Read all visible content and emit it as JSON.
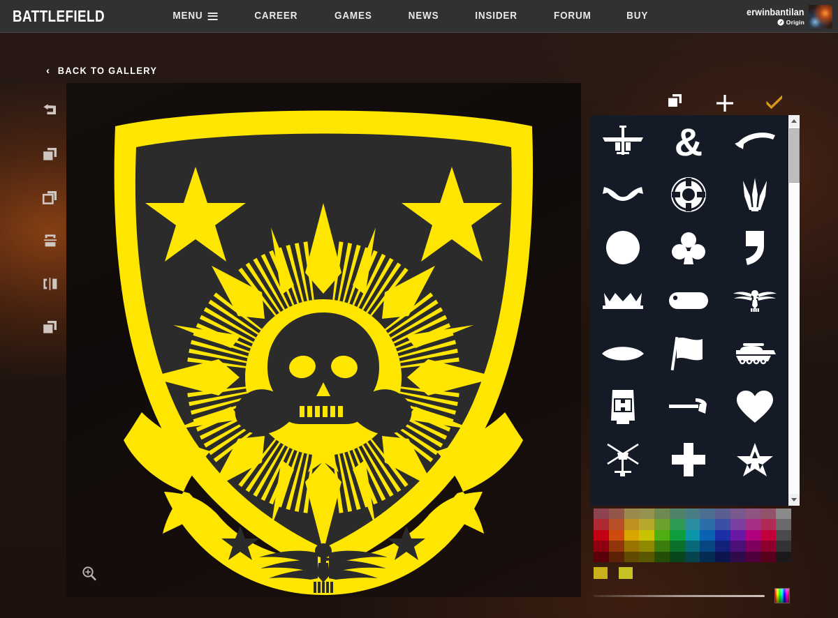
{
  "site": {
    "brand": "BATTLEFIELD",
    "nav": [
      {
        "label": "MENU",
        "icon": "hamburger-icon"
      },
      {
        "label": "CAREER",
        "icon": ""
      },
      {
        "label": "GAMES",
        "icon": ""
      },
      {
        "label": "NEWS",
        "icon": ""
      },
      {
        "label": "INSIDER",
        "icon": ""
      },
      {
        "label": "FORUM",
        "icon": ""
      },
      {
        "label": "BUY",
        "icon": ""
      }
    ],
    "user": {
      "username": "erwinbantilan",
      "platform": "Origin",
      "platform_icon": "origin-icon",
      "avatar_icon": "user-avatar"
    }
  },
  "back_link": {
    "chevron": "‹",
    "label": "BACK TO GALLERY"
  },
  "left_toolbar": {
    "items": [
      {
        "name": "undo-button",
        "icon": "undo-arrow-icon"
      },
      {
        "name": "duplicate-layer-button",
        "icon": "duplicate-filled-icon"
      },
      {
        "name": "copy-layer-button",
        "icon": "copy-outline-icon"
      },
      {
        "name": "flip-vertical-button",
        "icon": "flip-vertical-icon"
      },
      {
        "name": "flip-horizontal-button",
        "icon": "flip-horizontal-icon"
      },
      {
        "name": "layer-order-button",
        "icon": "layers-stack-icon"
      }
    ]
  },
  "canvas": {
    "zoom_button_icon": "zoom-in-icon",
    "emblem": {
      "name": "philippine-skull-shield-emblem",
      "shield_color": "#FFE600",
      "shield_fill": "#2B2B2B",
      "accent_color": "#FFE600",
      "background": "#120C0A",
      "layers": [
        {
          "name": "shield-outline",
          "color": "#FFE600"
        },
        {
          "name": "star-top-left",
          "color": "#FFE600"
        },
        {
          "name": "star-top-right",
          "color": "#FFE600"
        },
        {
          "name": "philippine-sunburst",
          "color": "#FFE600"
        },
        {
          "name": "skull-and-crossbones",
          "color": "#2B2B2B"
        },
        {
          "name": "small-star",
          "color": "#FFE600"
        },
        {
          "name": "ribbon-banner",
          "color": "#FFE600"
        },
        {
          "name": "banner-star-left",
          "color": "#2B2B2B"
        },
        {
          "name": "banner-star-right",
          "color": "#2B2B2B"
        },
        {
          "name": "eagle-insignia",
          "color": "#2B2B2B"
        }
      ]
    }
  },
  "right_panel": {
    "tabs": [
      {
        "name": "tab-layers",
        "icon": "layers-icon",
        "label": "",
        "active": false
      },
      {
        "name": "tab-add-shape",
        "icon": "plus-icon",
        "label": "",
        "active": true
      },
      {
        "name": "tab-confirm",
        "icon": "checkmark-icon",
        "label": "",
        "active": false,
        "color": "#D79A17"
      }
    ],
    "icon_grid": {
      "columns": 3,
      "icons": [
        {
          "name": "airplane-icon"
        },
        {
          "name": "ampersand-icon"
        },
        {
          "name": "curved-arrow-icon"
        },
        {
          "name": "banner-ribbon-icon"
        },
        {
          "name": "life-preserver-icon"
        },
        {
          "name": "grass-blades-icon"
        },
        {
          "name": "circle-icon"
        },
        {
          "name": "club-suit-icon"
        },
        {
          "name": "comma-icon"
        },
        {
          "name": "crown-icon"
        },
        {
          "name": "dog-tag-icon"
        },
        {
          "name": "eagle-wings-icon"
        },
        {
          "name": "lens-shape-icon"
        },
        {
          "name": "flag-icon"
        },
        {
          "name": "tank-icon"
        },
        {
          "name": "goggles-icon"
        },
        {
          "name": "hammer-icon"
        },
        {
          "name": "heart-icon"
        },
        {
          "name": "helicopter-icon"
        },
        {
          "name": "cross-plus-icon"
        },
        {
          "name": "star-outline-icon"
        }
      ]
    },
    "scrollbar": {
      "up_arrow": "scroll-up-arrow",
      "down_arrow": "scroll-down-arrow",
      "thumb_position": "top"
    },
    "color_palette": {
      "rows": [
        [
          "#8C4450",
          "#95564A",
          "#9A8A4E",
          "#95914E",
          "#6E8A52",
          "#4F8268",
          "#4A7E86",
          "#4C6E90",
          "#5B5E90",
          "#7A5A8E",
          "#8E5580",
          "#92526A",
          "#8A8A8A"
        ],
        [
          "#B02A36",
          "#B8512A",
          "#BF9120",
          "#B5A82A",
          "#6EA02F",
          "#2E9A55",
          "#2B8FA0",
          "#2A6FAA",
          "#3A4FA6",
          "#7A3FA0",
          "#A62E84",
          "#B02A55",
          "#6A6A6A"
        ],
        [
          "#C20014",
          "#CE4A0D",
          "#D9A600",
          "#C9C200",
          "#4FAE14",
          "#0F9E3E",
          "#0C94A8",
          "#0A62B4",
          "#1B2FA8",
          "#6A18A6",
          "#B00080",
          "#C2003C",
          "#4A4A4A"
        ],
        [
          "#8E0010",
          "#93350A",
          "#9A7400",
          "#8F8B00",
          "#3A7C0E",
          "#0B702C",
          "#086A78",
          "#064682",
          "#13217A",
          "#4C1178",
          "#7E005C",
          "#8C002B",
          "#333333"
        ],
        [
          "#5A000A",
          "#5C2106",
          "#624A00",
          "#5A5800",
          "#244E08",
          "#07461C",
          "#05434D",
          "#042C53",
          "#0C154D",
          "#300B4C",
          "#50003A",
          "#59001B",
          "#1A1A1A"
        ]
      ],
      "recent": [
        "#C9B11B",
        "#C9C224"
      ]
    },
    "opacity_slider": {
      "name": "opacity-slider",
      "value": 100
    },
    "color_picker": {
      "name": "color-picker-swatch"
    }
  }
}
